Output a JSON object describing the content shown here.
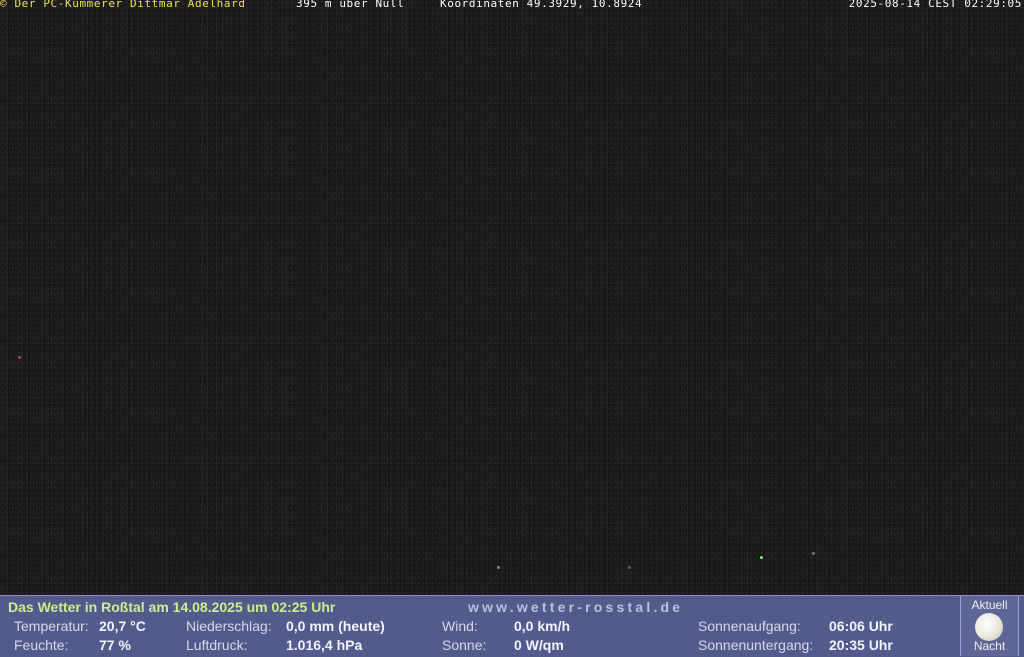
{
  "overlay": {
    "owner": "© Der PC-Kümmerer Dittmar Adelhard",
    "altitude": "395 m über Null",
    "coordinates": "Koordinaten 49.3929, 10.8924",
    "timestamp": "2025-08-14 CEST 02:29:05"
  },
  "weather": {
    "headline": "Das Wetter in Roßtal am 14.08.2025 um 02:25 Uhr",
    "site": "www.wetter-rosstal.de",
    "temperature_label": "Temperatur:",
    "temperature_value": "20,7 °C",
    "humidity_label": "Feuchte:",
    "humidity_value": "77 %",
    "precip_label": "Niederschlag:",
    "precip_value": "0,0 mm (heute)",
    "pressure_label": "Luftdruck:",
    "pressure_value": "1.016,4 hPa",
    "wind_label": "Wind:",
    "wind_value": "0,0 km/h",
    "sun_label": "Sonne:",
    "sun_value": "0 W/qm",
    "sunrise_label": "Sonnenaufgang:",
    "sunrise_value": "06:06 Uhr",
    "sunset_label": "Sonnenuntergang:",
    "sunset_value": "20:35 Uhr"
  },
  "moon": {
    "top_label": "Aktuell",
    "bottom_label": "Nacht",
    "icon": "full-moon-icon"
  }
}
